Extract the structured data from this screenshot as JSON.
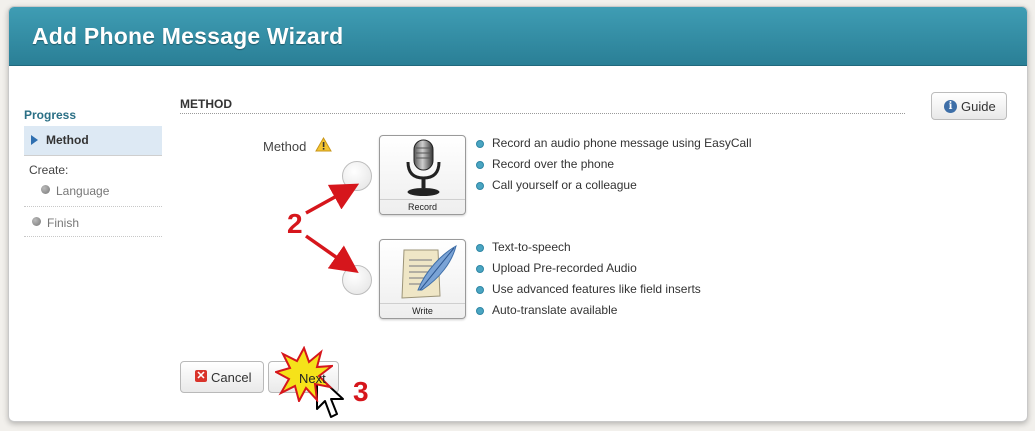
{
  "window": {
    "title": "Add Phone Message Wizard"
  },
  "sidebar": {
    "progress_title": "Progress",
    "method_label": "Method",
    "create_label": "Create:",
    "language_label": "Language",
    "finish_label": "Finish"
  },
  "main": {
    "section_title": "METHOD",
    "guide_label": "Guide",
    "method_label": "Method",
    "options": [
      {
        "caption": "Record",
        "bullets": [
          "Record an audio phone message using EasyCall",
          "Record over the phone",
          "Call yourself or a colleague"
        ]
      },
      {
        "caption": "Write",
        "bullets": [
          "Text-to-speech",
          "Upload Pre-recorded Audio",
          "Use advanced features like field inserts",
          "Auto-translate available"
        ]
      }
    ]
  },
  "footer": {
    "cancel_label": "Cancel",
    "next_label": "Next"
  },
  "annotations": {
    "step_2": "2",
    "step_3": "3"
  },
  "colors": {
    "titlebar": "#2f8aa2",
    "annotation": "#d6161c",
    "highlight": "#f5e21a"
  }
}
